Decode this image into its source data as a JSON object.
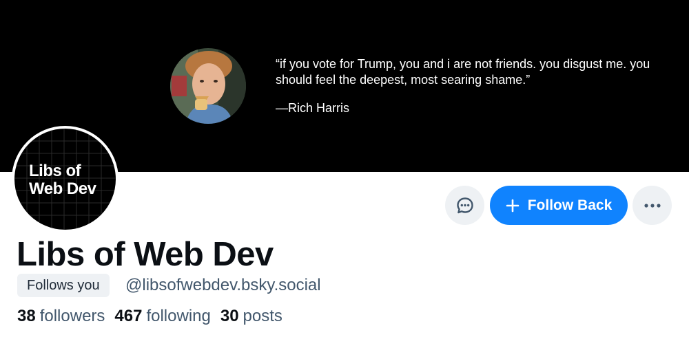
{
  "banner": {
    "quote": "“if you vote for Trump, you and i are not friends. you disgust me. you should feel the deepest, most searing shame.”",
    "attribution": "—Rich Harris",
    "background": "#000000"
  },
  "avatar": {
    "line1": "Libs of",
    "line2": "Web Dev"
  },
  "actions": {
    "message_icon": "chat-bubble-icon",
    "follow_label": "Follow Back",
    "follow_icon": "plus-icon",
    "more_icon": "ellipsis-icon",
    "accent": "#1083fe"
  },
  "profile": {
    "display_name": "Libs of Web Dev",
    "follows_you": "Follows you",
    "handle": "@libsofwebdev.bsky.social"
  },
  "stats": {
    "followers_count": "38",
    "followers_label": "followers",
    "following_count": "467",
    "following_label": "following",
    "posts_count": "30",
    "posts_label": "posts"
  }
}
